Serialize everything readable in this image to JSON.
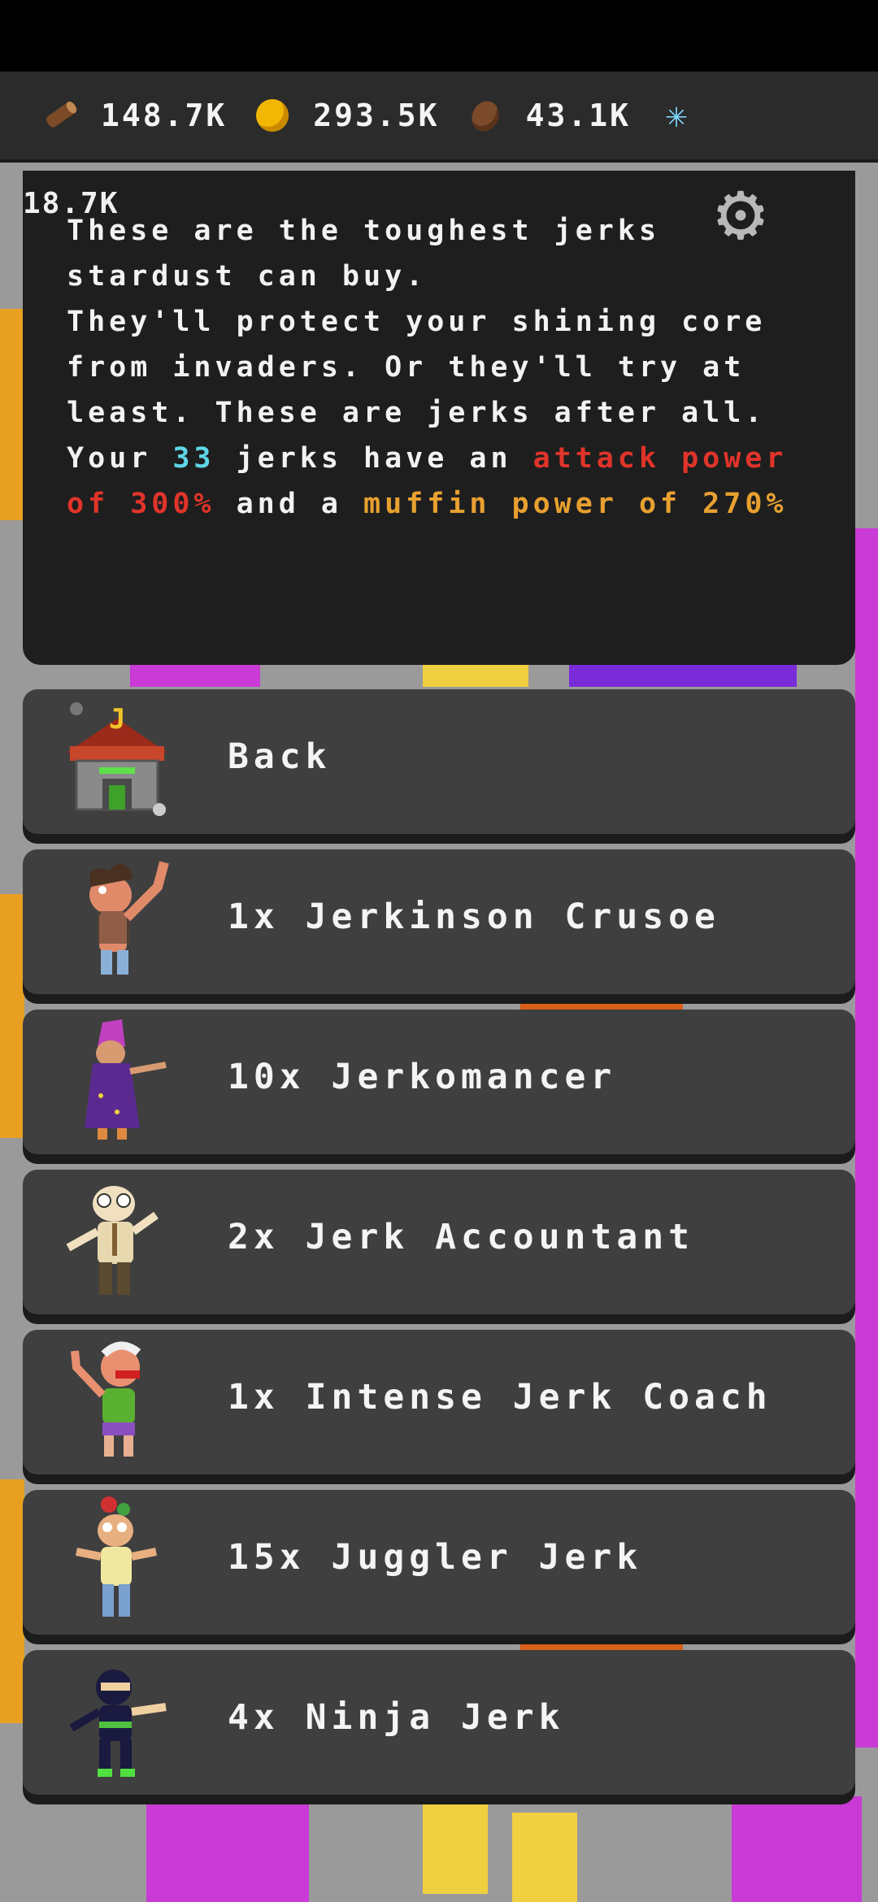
{
  "resources": {
    "wood": "148.7K",
    "coins": "293.5K",
    "beans": "43.1K",
    "stardust": "18.7K"
  },
  "info": {
    "line1": "These are the toughest jerks stardust can buy.",
    "line2": "They'll protect your shining core from invaders. Or they'll try at least. These are jerks after all.",
    "line3_prefix": "Your ",
    "jerk_count": "33",
    "line3_mid": " jerks have an ",
    "attack_text": "attack power of 300%",
    "line3_and": " and a ",
    "muffin_text": "muffin power of 270%"
  },
  "buttons": [
    {
      "label": "Back",
      "icon": "jerk-house-icon"
    },
    {
      "label": "1x Jerkinson Crusoe",
      "icon": "jerkinson-crusoe-icon"
    },
    {
      "label": "10x Jerkomancer",
      "icon": "jerkomancer-icon"
    },
    {
      "label": "2x Jerk Accountant",
      "icon": "jerk-accountant-icon"
    },
    {
      "label": "1x Intense Jerk Coach",
      "icon": "intense-jerk-coach-icon"
    },
    {
      "label": "15x Juggler Jerk",
      "icon": "juggler-jerk-icon"
    },
    {
      "label": "4x Ninja Jerk",
      "icon": "ninja-jerk-icon"
    }
  ],
  "colors": {
    "panel": "#1e1e1e",
    "button": "#3f3f3f",
    "count": "#5fd6e8",
    "attack": "#e0342a",
    "muffin": "#e8a030"
  }
}
